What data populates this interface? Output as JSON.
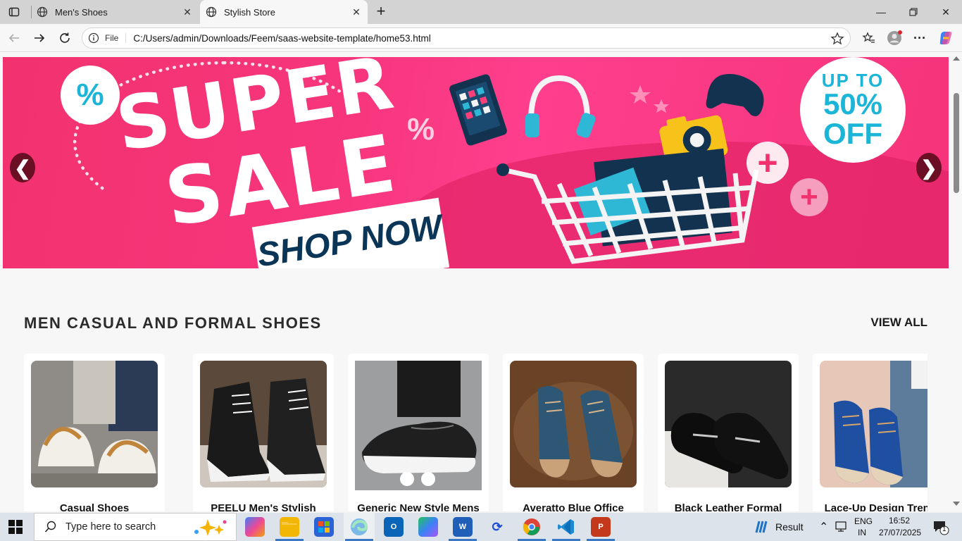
{
  "browser": {
    "tabs": [
      {
        "title": "Men's Shoes"
      },
      {
        "title": "Stylish Store"
      }
    ],
    "address": {
      "scheme_label": "File",
      "url": "C:/Users/admin/Downloads/Feem/saas-website-template/home53.html"
    }
  },
  "banner": {
    "headline_top": "SUPER",
    "headline_bottom": "SALE",
    "cta": "SHOP NOW",
    "badge_line1": "UP TO",
    "badge_line2": "50%",
    "badge_line3": "OFF",
    "percent_symbol": "%",
    "prev_label": "❮",
    "next_label": "❯",
    "colors": {
      "accent": "#f2326f",
      "badge_text": "#1bb5d8",
      "arrow_bg": "#6b0f25"
    }
  },
  "section": {
    "title": "MEN CASUAL AND FORMAL SHOES",
    "view_all": "VIEW ALL"
  },
  "products": [
    {
      "name": "Casual Shoes"
    },
    {
      "name": "PEELU Men's Stylish"
    },
    {
      "name": "Generic New Style Mens"
    },
    {
      "name": "Averatto Blue Office"
    },
    {
      "name": "Black Leather Formal"
    },
    {
      "name": "Lace-Up Design Trendy"
    }
  ],
  "taskbar": {
    "search_placeholder": "Type here to search",
    "weather": "Result",
    "lang_top": "ENG",
    "lang_bottom": "IN",
    "time": "16:52",
    "date": "27/07/2025",
    "notification_count": "1"
  }
}
